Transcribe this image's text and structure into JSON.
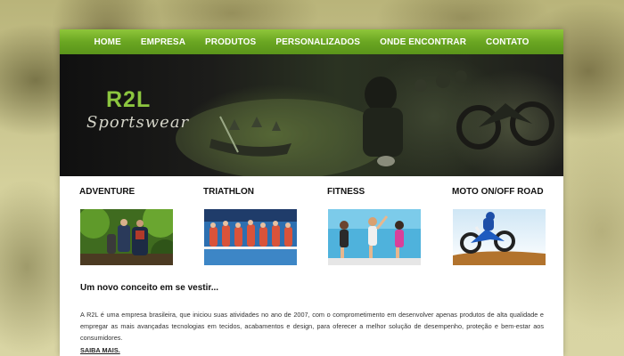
{
  "nav": {
    "items": [
      "HOME",
      "EMPRESA",
      "PRODUTOS",
      "PERSONALIZADOS",
      "ONDE ENCONTRAR",
      "CONTATO"
    ]
  },
  "banner": {
    "logo_main": "R2L",
    "logo_sub": "Sportswear"
  },
  "categories": [
    {
      "title": "ADVENTURE"
    },
    {
      "title": "TRIATHLON"
    },
    {
      "title": "FITNESS"
    },
    {
      "title": "MOTO ON/OFF ROAD"
    }
  ],
  "content": {
    "headline": "Um novo conceito em se vestir...",
    "paragraph": "A R2L é uma empresa brasileira, que iniciou suas atividades no ano de 2007, com o comprometimento em desenvolver apenas produtos de alta qualidade e empregar as mais avançadas tecnologias em tecidos, acabamentos e design, para oferecer a melhor solução de desempenho, proteção e bem-estar aos consumidores.",
    "more_link": "SAIBA MAIS."
  },
  "colors": {
    "nav_green": "#6aa622",
    "logo_green": "#8cc63f",
    "page_bg": "#cfcb93"
  }
}
